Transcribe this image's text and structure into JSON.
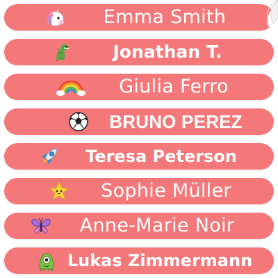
{
  "colors": {
    "label_background": "#f4787a",
    "label_text": "#ffffff"
  },
  "labels": [
    {
      "name": "Emma Smith",
      "icon": "unicorn-icon"
    },
    {
      "name": "Jonathan T.",
      "icon": "dinosaur-icon"
    },
    {
      "name": "Giulia Ferro",
      "icon": "rainbow-icon"
    },
    {
      "name": "BRUNO PEREZ",
      "icon": "soccer-ball-icon"
    },
    {
      "name": "Teresa Peterson",
      "icon": "rocket-icon"
    },
    {
      "name": "Sophie Müller",
      "icon": "star-icon"
    },
    {
      "name": "Anne-Marie Noir",
      "icon": "butterfly-icon"
    },
    {
      "name": "Lukas Zimmermann",
      "icon": "alien-icon"
    }
  ]
}
